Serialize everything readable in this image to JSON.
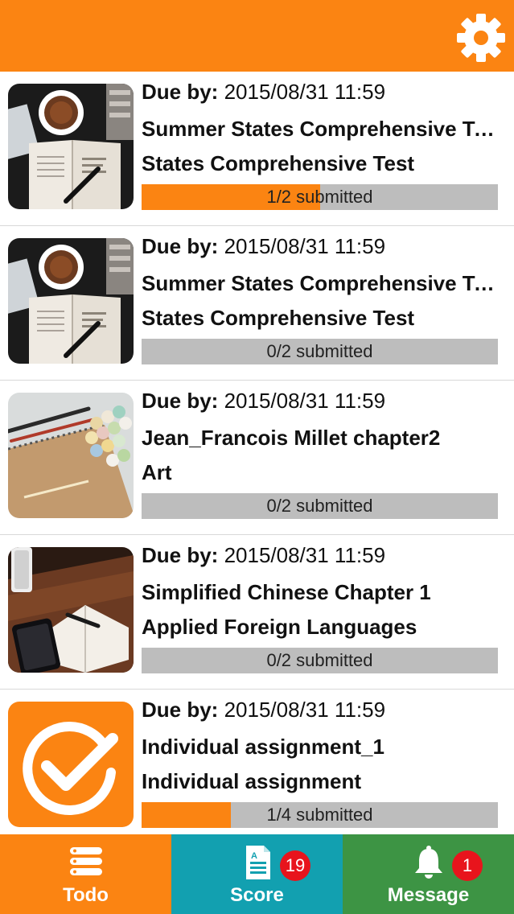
{
  "header": {
    "settings_icon": "gear-icon",
    "accent_color": "#fb8412"
  },
  "assignments": [
    {
      "thumbnail": "coffee-book-photo",
      "due_label": "Due by:",
      "due_date": "2015/08/31 11:59",
      "title": "Summer States Comprehensive Test",
      "subject": "States Comprehensive Test",
      "submitted": 1,
      "total": 2,
      "progress_text": "1/2 submitted"
    },
    {
      "thumbnail": "coffee-book-photo",
      "due_label": "Due by:",
      "due_date": "2015/08/31 11:59",
      "title": "Summer States Comprehensive Test",
      "subject": "States Comprehensive Test",
      "submitted": 0,
      "total": 2,
      "progress_text": "0/2 submitted"
    },
    {
      "thumbnail": "markers-notebook-photo",
      "due_label": "Due by:",
      "due_date": "2015/08/31 11:59",
      "title": "Jean_Francois Millet chapter2",
      "subject": "Art",
      "submitted": 0,
      "total": 2,
      "progress_text": "0/2 submitted"
    },
    {
      "thumbnail": "phone-notebook-photo",
      "due_label": "Due by:",
      "due_date": "2015/08/31 11:59",
      "title": "Simplified Chinese Chapter 1",
      "subject": "Applied Foreign Languages",
      "submitted": 0,
      "total": 2,
      "progress_text": "0/2 submitted"
    },
    {
      "thumbnail": "checkmark-app-icon",
      "due_label": "Due by:",
      "due_date": "2015/08/31 11:59",
      "title": "Individual assignment_1",
      "subject": "Individual assignment",
      "submitted": 1,
      "total": 4,
      "progress_text": "1/4 submitted"
    }
  ],
  "tabbar": {
    "todo": {
      "label": "Todo",
      "icon": "list-icon",
      "color": "#fb8412"
    },
    "score": {
      "label": "Score",
      "icon": "document-icon",
      "badge": "19",
      "color": "#12a0b0"
    },
    "message": {
      "label": "Message",
      "icon": "bell-icon",
      "badge": "1",
      "color": "#3d9444"
    }
  }
}
